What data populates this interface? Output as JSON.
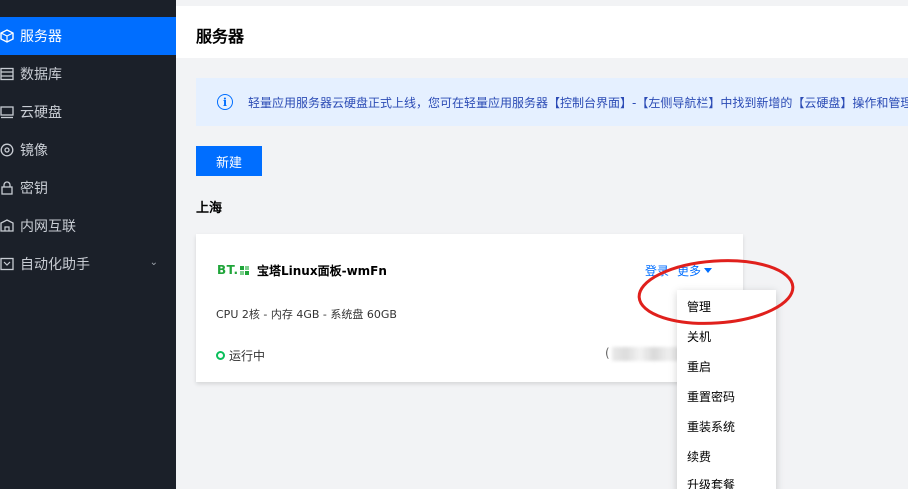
{
  "sidebar": {
    "items": [
      {
        "label": "服务器",
        "icon": "server-cube-icon",
        "active": true
      },
      {
        "label": "数据库",
        "icon": "database-icon"
      },
      {
        "label": "云硬盘",
        "icon": "cloud-disk-icon"
      },
      {
        "label": "镜像",
        "icon": "image-disc-icon"
      },
      {
        "label": "密钥",
        "icon": "key-icon"
      },
      {
        "label": "内网互联",
        "icon": "network-icon"
      },
      {
        "label": "自动化助手",
        "icon": "automation-icon",
        "expandable": true
      }
    ]
  },
  "header": {
    "title": "服务器"
  },
  "notice": {
    "icon": "info-icon",
    "text": "轻量应用服务器云硬盘正式上线，您可在轻量应用服务器【控制台界面】-【左侧导航栏】中找到新增的【云硬盘】操作和管理"
  },
  "toolbar": {
    "new_label": "新建"
  },
  "region": {
    "name": "上海"
  },
  "server_card": {
    "logo_text": "BT.",
    "name": "宝塔Linux面板-wmFn",
    "login_label": "登录",
    "more_label": "更多",
    "specs": "CPU 2核 - 内存 4GB - 系统盘 60GB",
    "status": "运行中",
    "ip_prefix": "("
  },
  "more_menu": {
    "items": [
      "管理",
      "关机",
      "重启",
      "重置密码",
      "重装系统",
      "续费",
      "升级套餐"
    ]
  },
  "colors": {
    "primary": "#006eff",
    "sidebar_bg": "#1b2029",
    "status_green": "#0abf5b",
    "annotation_red": "#e0201c",
    "bt_green": "#20a53a"
  }
}
